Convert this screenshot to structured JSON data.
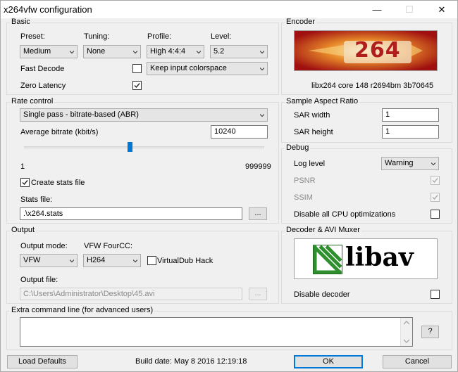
{
  "window": {
    "title": "x264vfw configuration",
    "minimize_glyph": "—",
    "maximize_glyph": "☐",
    "close_glyph": "✕"
  },
  "basic": {
    "title": "Basic",
    "preset": {
      "label": "Preset:",
      "value": "Medium"
    },
    "tuning": {
      "label": "Tuning:",
      "value": "None"
    },
    "profile": {
      "label": "Profile:",
      "value": "High 4:4:4"
    },
    "level": {
      "label": "Level:",
      "value": "5.2"
    },
    "fast_decode": {
      "label": "Fast Decode",
      "checked": false
    },
    "colorspace": {
      "value": "Keep input colorspace"
    },
    "zero_latency": {
      "label": "Zero Latency",
      "checked": true
    }
  },
  "encoder": {
    "title": "Encoder",
    "logo_text": "264",
    "version": "libx264 core 148 r2694bm 3b70645"
  },
  "rate_control": {
    "title": "Rate control",
    "mode": "Single pass - bitrate-based (ABR)",
    "bitrate_label": "Average bitrate (kbit/s)",
    "bitrate_value": "10240",
    "slider_min": "1",
    "slider_max": "999999",
    "slider_fraction": 0.44,
    "create_stats": {
      "label": "Create stats file",
      "checked": true
    },
    "stats_file_label": "Stats file:",
    "stats_file_value": ".\\x264.stats",
    "browse_label": "..."
  },
  "sar": {
    "title": "Sample Aspect Ratio",
    "width_label": "SAR width",
    "width_value": "1",
    "height_label": "SAR height",
    "height_value": "1"
  },
  "debug": {
    "title": "Debug",
    "log_level_label": "Log level",
    "log_level_value": "Warning",
    "psnr_label": "PSNR",
    "psnr_checked": true,
    "ssim_label": "SSIM",
    "ssim_checked": true,
    "disable_cpu_label": "Disable all CPU optimizations",
    "disable_cpu_checked": false
  },
  "output": {
    "title": "Output",
    "mode_label": "Output mode:",
    "mode_value": "VFW",
    "fourcc_label": "VFW FourCC:",
    "fourcc_value": "H264",
    "vdub_hack_label": "VirtualDub Hack",
    "vdub_hack_checked": false,
    "file_label": "Output file:",
    "file_value": "C:\\Users\\Administrator\\Desktop\\45.avi",
    "browse_label": "..."
  },
  "decoder": {
    "title": "Decoder & AVI Muxer",
    "logo_text": "libav",
    "disable_label": "Disable decoder",
    "disable_checked": false
  },
  "extra": {
    "title": "Extra command line (for advanced users)",
    "value": "",
    "help_label": "?"
  },
  "footer": {
    "load_defaults": "Load Defaults",
    "build_date": "Build date: May  8 2016 12:19:18",
    "ok": "OK",
    "cancel": "Cancel"
  },
  "colors": {
    "accent": "#0078d7",
    "logo264_red": "#b11e1e",
    "libav_green": "#2f8f2f"
  }
}
